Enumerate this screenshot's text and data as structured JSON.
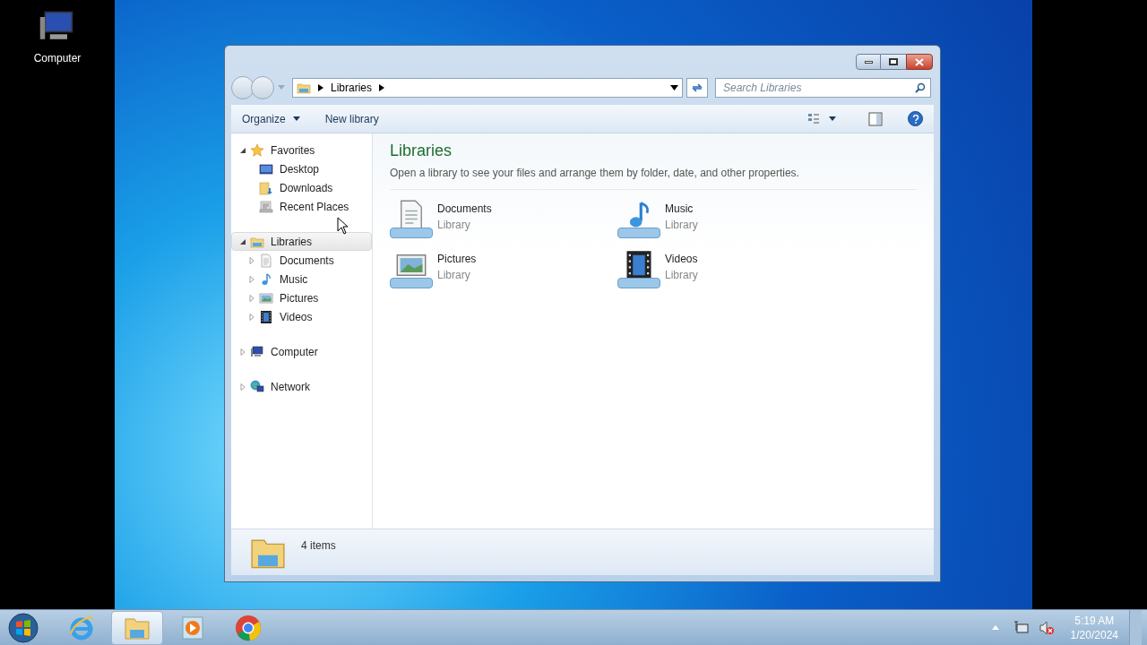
{
  "desktop_icons": [
    {
      "label": "Computer",
      "kind": "computer"
    }
  ],
  "window": {
    "address": {
      "segments": [
        "Libraries"
      ]
    },
    "search": {
      "placeholder": "Search Libraries"
    },
    "toolbar": [
      {
        "label": "Organize",
        "kind": "menu"
      },
      {
        "label": "New library",
        "kind": "plain"
      }
    ],
    "nav": [
      {
        "label": "Favorites",
        "kind": "star",
        "expanded": true,
        "selected": false,
        "children": [
          {
            "label": "Desktop",
            "kind": "desktop",
            "expandable": false
          },
          {
            "label": "Downloads",
            "kind": "downloads",
            "expandable": false
          },
          {
            "label": "Recent Places",
            "kind": "recent",
            "expandable": false
          }
        ]
      },
      {
        "label": "Libraries",
        "kind": "libraries",
        "expanded": true,
        "selected": true,
        "children": [
          {
            "label": "Documents",
            "kind": "document",
            "expandable": true
          },
          {
            "label": "Music",
            "kind": "music",
            "expandable": true
          },
          {
            "label": "Pictures",
            "kind": "picture",
            "expandable": true
          },
          {
            "label": "Videos",
            "kind": "video",
            "expandable": true
          }
        ]
      },
      {
        "label": "Computer",
        "kind": "computer",
        "expanded": false,
        "selected": false
      },
      {
        "label": "Network",
        "kind": "network",
        "expanded": false,
        "selected": false
      }
    ],
    "content": {
      "title": "Libraries",
      "description": "Open a library to see your files and arrange them by folder, date, and other properties.",
      "items": [
        {
          "name": "Documents",
          "subtitle": "Library",
          "kind": "document"
        },
        {
          "name": "Music",
          "subtitle": "Library",
          "kind": "music"
        },
        {
          "name": "Pictures",
          "subtitle": "Library",
          "kind": "picture"
        },
        {
          "name": "Videos",
          "subtitle": "Library",
          "kind": "video"
        }
      ]
    },
    "status": {
      "text": "4 items"
    }
  },
  "taskbar": {
    "apps": [
      {
        "kind": "ie",
        "selected": false
      },
      {
        "kind": "explorer",
        "selected": true
      },
      {
        "kind": "media",
        "selected": false
      },
      {
        "kind": "chrome",
        "selected": false
      }
    ],
    "clock": {
      "time": "5:19 AM",
      "date": "1/20/2024"
    }
  }
}
